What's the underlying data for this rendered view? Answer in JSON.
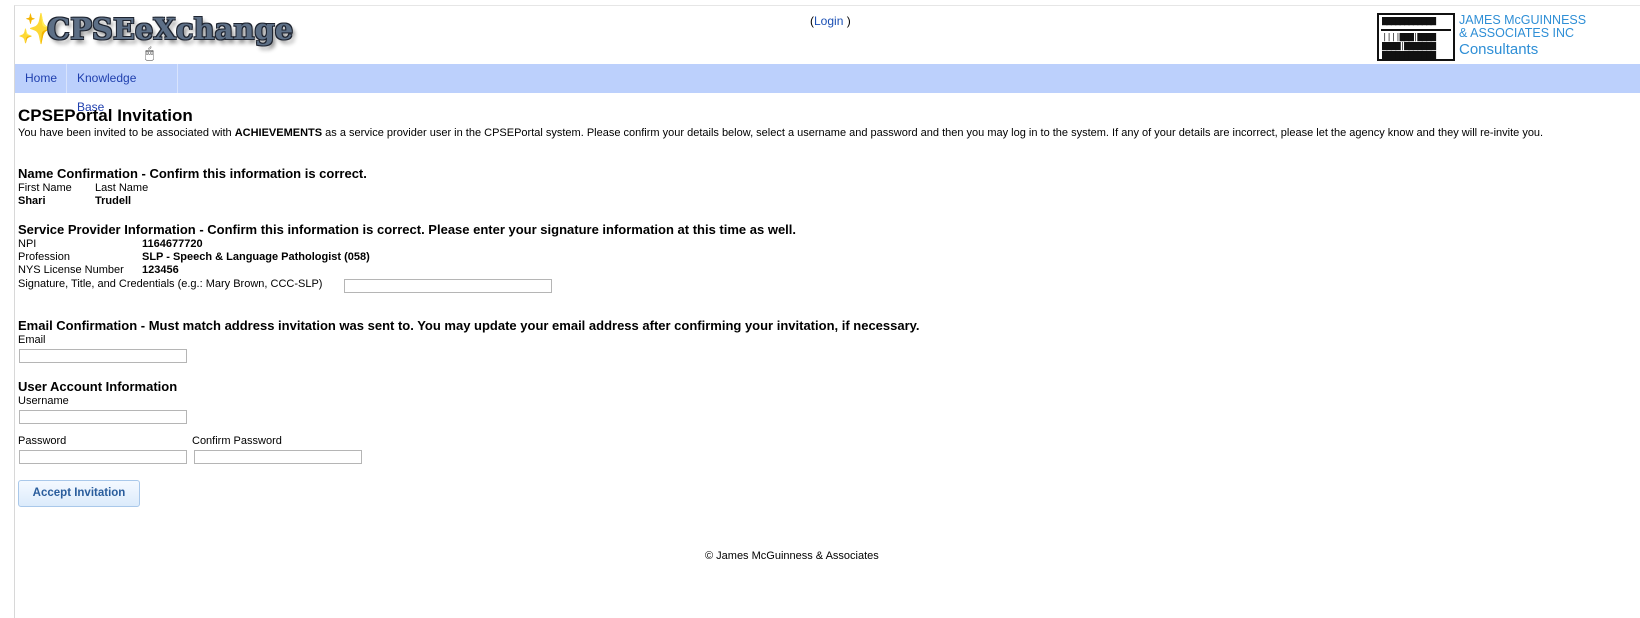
{
  "header": {
    "logo_text": "CPSEeXchange",
    "login_open": "(",
    "login_link": "Login",
    "login_close": " )",
    "brand_line1": "JAMES McGUINNESS",
    "brand_line2": "& ASSOCIATES INC",
    "brand_line3": "Consultants"
  },
  "nav": {
    "items": [
      "Home",
      "Knowledge Base"
    ]
  },
  "page": {
    "title": "CPSEPortal Invitation",
    "intro_before": "You have been invited to be associated with ",
    "intro_agency": "ACHIEVEMENTS",
    "intro_after": " as a service provider user in the CPSEPortal system. Please confirm your details below, select a username and password and then you may log in to the system. If any of your details are incorrect, please let the agency know and they will re-invite you."
  },
  "name_section": {
    "heading": "Name Confirmation - Confirm this information is correct.",
    "first_name_label": "First Name",
    "last_name_label": "Last Name",
    "first_name": "Shari",
    "last_name": "Trudell"
  },
  "provider_section": {
    "heading": "Service Provider Information - Confirm this information is correct. Please enter your signature information at this time as well.",
    "npi_label": "NPI",
    "npi": "1164677720",
    "profession_label": "Profession",
    "profession": "SLP - Speech & Language Pathologist (058)",
    "license_label": "NYS License Number",
    "license": "123456",
    "signature_label": "Signature, Title, and Credentials (e.g.: Mary Brown, CCC-SLP)",
    "signature_value": ""
  },
  "email_section": {
    "heading": "Email Confirmation - Must match address invitation was sent to. You may update your email address after confirming your invitation, if necessary.",
    "email_label": "Email",
    "email_value": ""
  },
  "account_section": {
    "heading": "User Account Information",
    "username_label": "Username",
    "username_value": "",
    "password_label": "Password",
    "confirm_password_label": "Confirm Password"
  },
  "actions": {
    "accept_label": "Accept Invitation"
  },
  "footer": {
    "copyright": "© James McGuinness & Associates"
  },
  "icons": {
    "logo_swirl": "swirl-icon",
    "cursor": "mouse-cursor-icon",
    "abacus": "abacus-logo-icon"
  },
  "colors": {
    "nav_bg": "#bcd0fc",
    "nav_link": "#1f3fae",
    "brand": "#2f8fd6",
    "button_text": "#2a5d9c"
  }
}
